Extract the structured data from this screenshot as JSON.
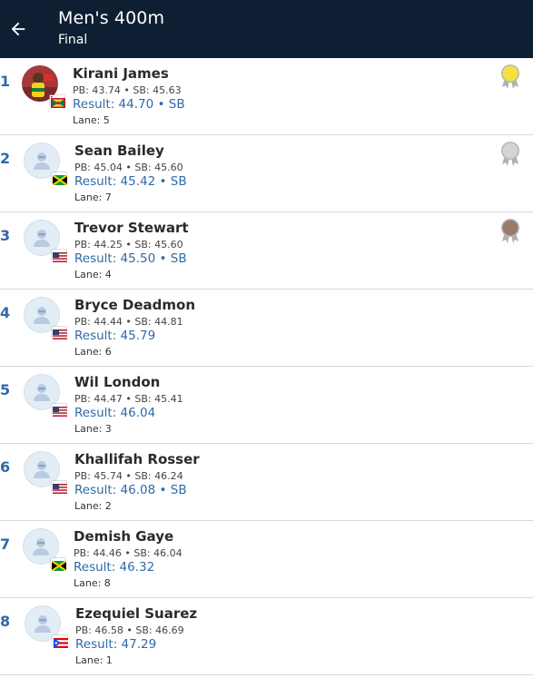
{
  "header": {
    "title": "Men's 400m",
    "subtitle": "Final"
  },
  "colors": {
    "header_bg": "#0f1f33",
    "accent": "#2f6aa8",
    "gold": "#f5e03c",
    "silver": "#d4d4d4",
    "bronze": "#9a7a6a"
  },
  "results": [
    {
      "rank": "1",
      "name": "Kirani James",
      "pbsb": "PB: 43.74 • SB: 45.63",
      "result": "Result: 44.70 • SB",
      "lane": "Lane: 5",
      "country": "GRN",
      "flag_icon": "grenada-flag",
      "photo": true,
      "medal": "gold"
    },
    {
      "rank": "2",
      "name": "Sean Bailey",
      "pbsb": "PB: 45.04 • SB: 45.60",
      "result": "Result: 45.42 • SB",
      "lane": "Lane: 7",
      "country": "JAM",
      "flag_icon": "jamaica-flag",
      "photo": false,
      "medal": "silver"
    },
    {
      "rank": "3",
      "name": "Trevor Stewart",
      "pbsb": "PB: 44.25 • SB: 45.60",
      "result": "Result: 45.50 • SB",
      "lane": "Lane: 4",
      "country": "USA",
      "flag_icon": "usa-flag",
      "photo": false,
      "medal": "bronze"
    },
    {
      "rank": "4",
      "name": "Bryce Deadmon",
      "pbsb": "PB: 44.44 • SB: 44.81",
      "result": "Result: 45.79",
      "lane": "Lane: 6",
      "country": "USA",
      "flag_icon": "usa-flag",
      "photo": false,
      "medal": ""
    },
    {
      "rank": "5",
      "name": "Wil London",
      "pbsb": "PB: 44.47 • SB: 45.41",
      "result": "Result: 46.04",
      "lane": "Lane: 3",
      "country": "USA",
      "flag_icon": "usa-flag",
      "photo": false,
      "medal": ""
    },
    {
      "rank": "6",
      "name": "Khallifah Rosser",
      "pbsb": "PB: 45.74 • SB: 46.24",
      "result": "Result: 46.08 • SB",
      "lane": "Lane: 2",
      "country": "USA",
      "flag_icon": "usa-flag",
      "photo": false,
      "medal": ""
    },
    {
      "rank": "7",
      "name": "Demish Gaye",
      "pbsb": "PB: 44.46 • SB: 46.04",
      "result": "Result: 46.32",
      "lane": "Lane: 8",
      "country": "JAM",
      "flag_icon": "jamaica-flag",
      "photo": false,
      "medal": ""
    },
    {
      "rank": "8",
      "name": "Ezequiel Suarez",
      "pbsb": "PB: 46.58 • SB: 46.69",
      "result": "Result: 47.29",
      "lane": "Lane: 1",
      "country": "PUR",
      "flag_icon": "puerto-rico-flag",
      "photo": false,
      "medal": ""
    }
  ]
}
